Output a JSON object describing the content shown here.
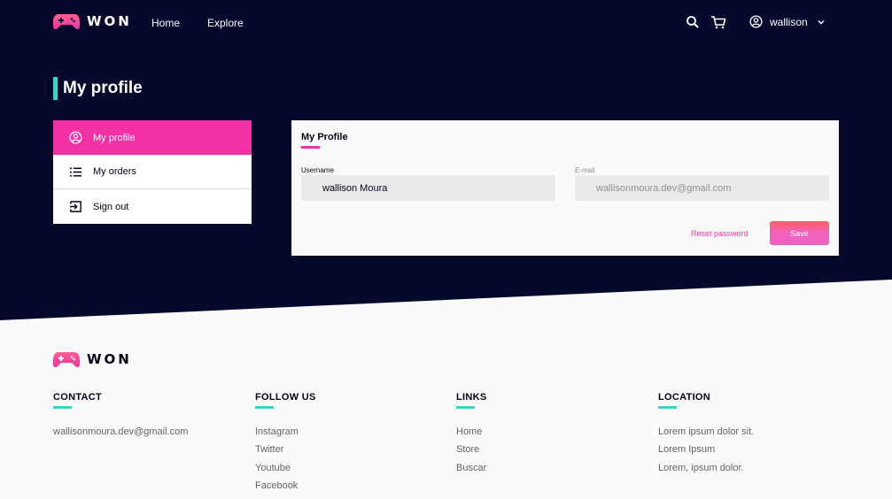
{
  "brand": {
    "name": "WON",
    "accent": "#f231a5",
    "secondary": "#3cd3c1",
    "dark": "#06092b"
  },
  "header": {
    "nav": {
      "home": "Home",
      "explore": "Explore"
    },
    "icons": {
      "search": "search-icon",
      "cart": "cart-icon",
      "account": "account-circle-icon"
    },
    "user": {
      "name": "wallison"
    }
  },
  "page": {
    "title": "My profile"
  },
  "side_menu": {
    "items": [
      {
        "label": "My profile",
        "icon": "account-circle-icon",
        "active": true
      },
      {
        "label": "My orders",
        "icon": "list-icon",
        "active": false
      },
      {
        "label": "Sign out",
        "icon": "sign-out-icon",
        "active": false
      }
    ]
  },
  "profile_form": {
    "title": "My Profile",
    "username_label": "Username",
    "username_value": "wallison Moura",
    "email_label": "E-mail",
    "email_value": "wallisonmoura.dev@gmail.com",
    "reset_password": "Reset password",
    "save": "Save"
  },
  "footer": {
    "contact": {
      "title": "CONTACT",
      "items": [
        "wallisonmoura.dev@gmail.com"
      ]
    },
    "follow": {
      "title": "FOLLOW US",
      "items": [
        "Instagram",
        "Twitter",
        "Youtube",
        "Facebook"
      ]
    },
    "links": {
      "title": "LINKS",
      "items": [
        "Home",
        "Store",
        "Buscar"
      ]
    },
    "location": {
      "title": "LOCATION",
      "items": [
        "Lorem ipsum dolor sit.",
        "Lorem Ipsum",
        "Lorem, ipsum dolor."
      ]
    }
  }
}
